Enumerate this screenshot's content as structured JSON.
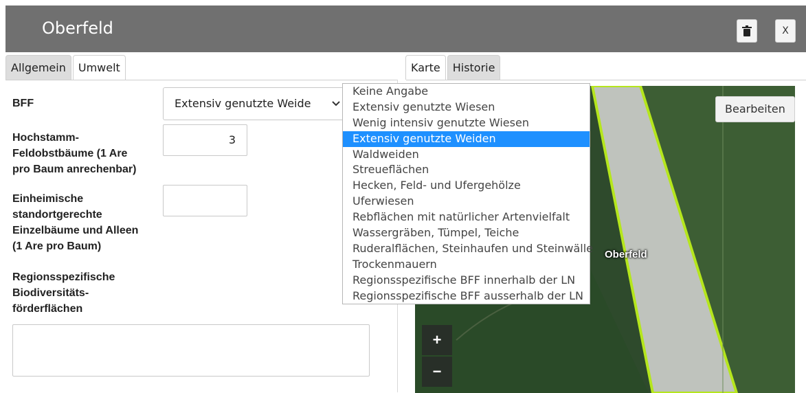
{
  "window": {
    "title": "Oberfeld",
    "delete_icon": "trash-icon",
    "close_label": "X"
  },
  "left_tabs": [
    {
      "label": "Allgemein"
    },
    {
      "label": "Umwelt"
    }
  ],
  "right_tabs": [
    {
      "label": "Karte"
    },
    {
      "label": "Historie"
    }
  ],
  "form": {
    "bff_label": "BFF",
    "bff_value": "Extensiv genutzte Weide",
    "hochstamm_label_1": "Hochstamm-",
    "hochstamm_label_2": "Feldobstbäume (1 Are",
    "hochstamm_label_3": "pro Baum anrechenbar)",
    "hochstamm_value": "3",
    "einheimisch_label_1": "Einheimische",
    "einheimisch_label_2": "standortgerechte",
    "einheimisch_label_3": "Einzelbäume und Alleen",
    "einheimisch_label_4": "(1 Are pro Baum)",
    "einheimisch_value": "",
    "regions_label_1": "Regionsspezifische",
    "regions_label_2": "Biodiversitäts-",
    "regions_label_3": "förderflächen",
    "regions_value": ""
  },
  "dropdown": {
    "selected_index": 3,
    "options": [
      "Keine Angabe",
      "Extensiv genutzte Wiesen",
      "Wenig intensiv genutzte Wiesen",
      "Extensiv genutzte Weiden",
      "Waldweiden",
      "Streueflächen",
      "Hecken, Feld- und Ufergehölze",
      "Uferwiesen",
      "Rebflächen mit natürlicher Artenvielfalt",
      "Wassergräben, Tümpel, Teiche",
      "Ruderalflächen, Steinhaufen und Steinwälle",
      "Trockenmauern",
      "Regionsspezifische BFF innerhalb der LN",
      "Regionsspezifische BFF ausserhalb der LN"
    ]
  },
  "map": {
    "edit_label": "Bearbeiten",
    "parcel_label": "Oberfeld",
    "zoom_in": "+",
    "zoom_out": "−",
    "parcel_outline_color": "#b5e61d"
  }
}
